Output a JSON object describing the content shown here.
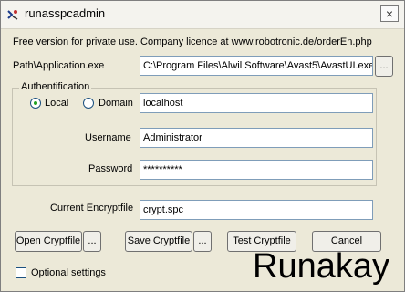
{
  "window": {
    "title": "runasspcadmin",
    "close_glyph": "×",
    "icon_name": "app-keys-icon"
  },
  "notice": "Free version for private use. Company licence at www.robotronic.de/orderEn.php",
  "path": {
    "label": "Path\\Application.exe",
    "value": "C:\\Program Files\\Alwil Software\\Avast5\\AvastUI.exe",
    "browse_label": "..."
  },
  "auth": {
    "legend": "Authentification",
    "local_label": "Local",
    "domain_label": "Domain",
    "selected": "Local",
    "domain_value": "localhost",
    "username_label": "Username",
    "username_value": "Administrator",
    "password_label": "Password",
    "password_value": "**********"
  },
  "cryptfile": {
    "label": "Current Encryptfile",
    "value": "crypt.spc"
  },
  "buttons": {
    "open": "Open Cryptfile",
    "open_more": "...",
    "save": "Save Cryptfile",
    "save_more": "...",
    "test": "Test Cryptfile",
    "cancel": "Cancel"
  },
  "optional": {
    "label": "Optional settings",
    "checked": false
  },
  "brand": "Runakay"
}
